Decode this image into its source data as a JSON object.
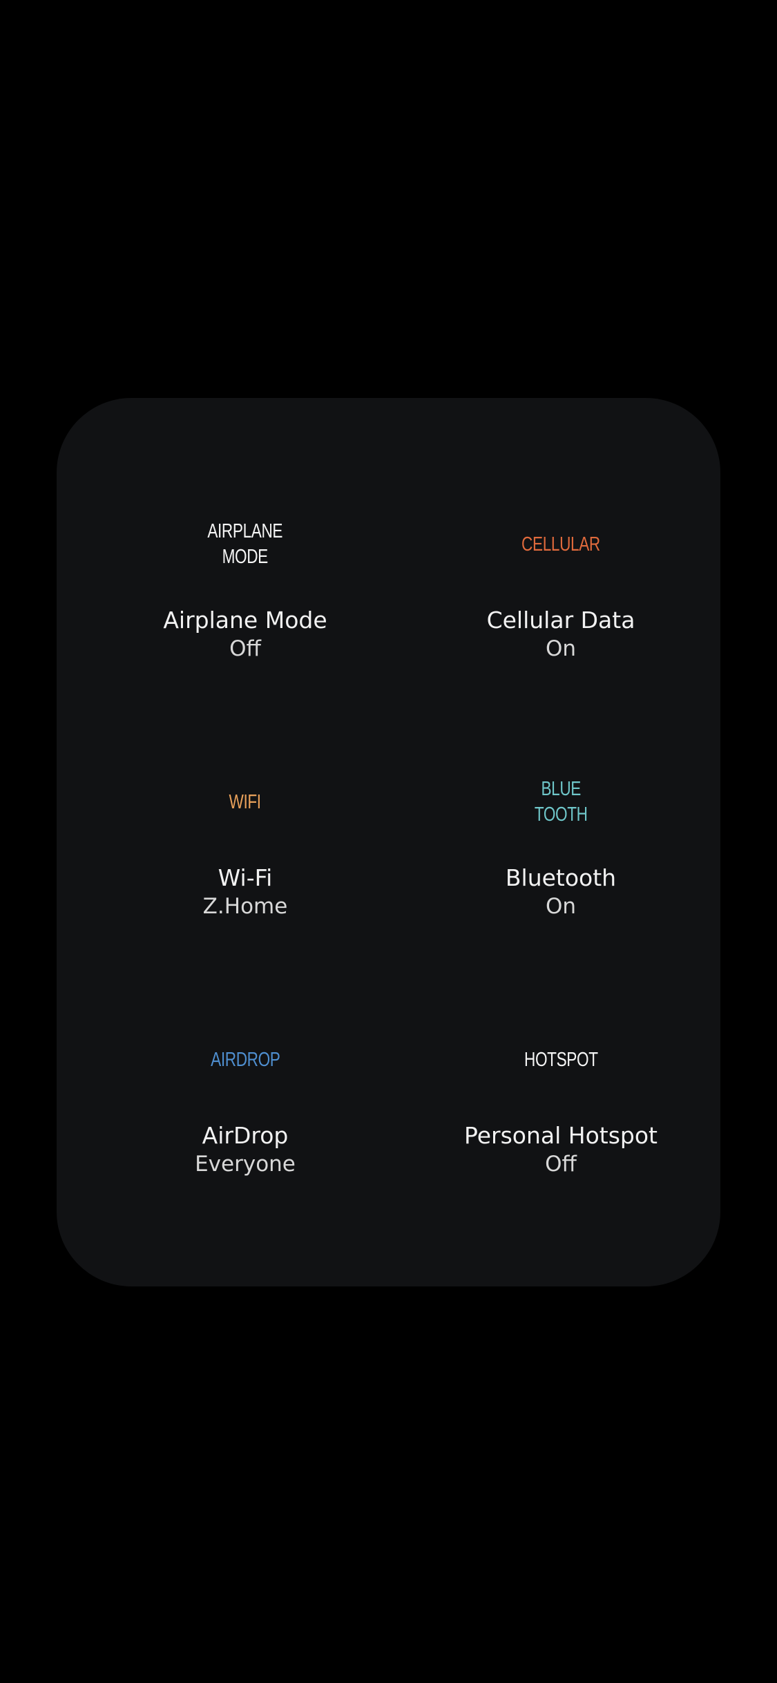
{
  "colors": {
    "background": "#000000",
    "panel": "#111214",
    "airplane": "#f5f5f5",
    "cellular": "#e06a3c",
    "wifi": "#e8a05a",
    "bluetooth": "#6fc6c9",
    "airdrop": "#4f8fd0",
    "hotspot": "#f5f5f5"
  },
  "controls": [
    {
      "id": "airplane",
      "tag": "AIRPLANE\nMODE",
      "name": "Airplane Mode",
      "state": "Off"
    },
    {
      "id": "cellular",
      "tag": "CELLULAR",
      "name": "Cellular Data",
      "state": "On"
    },
    {
      "id": "wifi",
      "tag": "WIFI",
      "name": "Wi-Fi",
      "state": "Z.Home"
    },
    {
      "id": "bluetooth",
      "tag": "BLUE\nTOOTH",
      "name": "Bluetooth",
      "state": "On"
    },
    {
      "id": "airdrop",
      "tag": "AIRDROP",
      "name": "AirDrop",
      "state": "Everyone"
    },
    {
      "id": "hotspot",
      "tag": "HOTSPOT",
      "name": "Personal Hotspot",
      "state": "Off"
    }
  ]
}
